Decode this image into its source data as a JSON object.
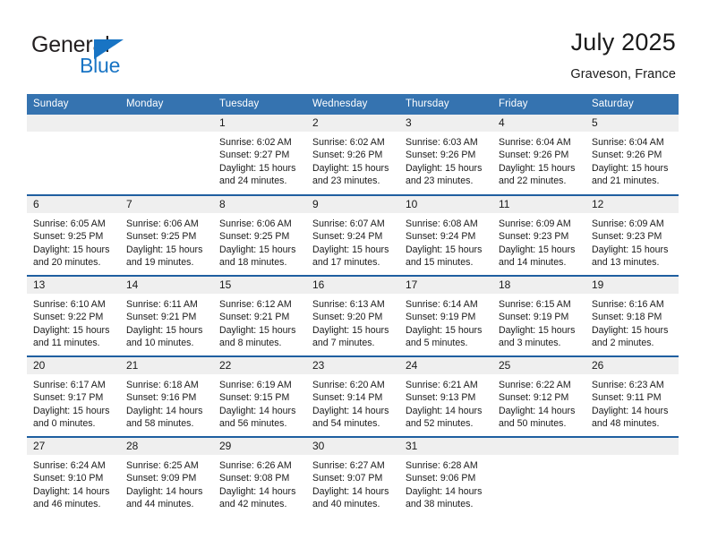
{
  "brand": {
    "name_top": "General",
    "name_bottom": "Blue",
    "triangle_icon": "triangle-icon",
    "accent_color": "#1874c4"
  },
  "header": {
    "title": "July 2025",
    "subtitle": "Graveson, France"
  },
  "colors": {
    "header_blue": "#3573b0",
    "row_rule_blue": "#1f5fa0",
    "daynum_band": "#efefef"
  },
  "calendar": {
    "day_headers": [
      "Sunday",
      "Monday",
      "Tuesday",
      "Wednesday",
      "Thursday",
      "Friday",
      "Saturday"
    ],
    "weeks": [
      [
        {
          "day": "",
          "sunrise": "",
          "sunset": "",
          "daylight": ""
        },
        {
          "day": "",
          "sunrise": "",
          "sunset": "",
          "daylight": ""
        },
        {
          "day": "1",
          "sunrise": "Sunrise: 6:02 AM",
          "sunset": "Sunset: 9:27 PM",
          "daylight": "Daylight: 15 hours and 24 minutes."
        },
        {
          "day": "2",
          "sunrise": "Sunrise: 6:02 AM",
          "sunset": "Sunset: 9:26 PM",
          "daylight": "Daylight: 15 hours and 23 minutes."
        },
        {
          "day": "3",
          "sunrise": "Sunrise: 6:03 AM",
          "sunset": "Sunset: 9:26 PM",
          "daylight": "Daylight: 15 hours and 23 minutes."
        },
        {
          "day": "4",
          "sunrise": "Sunrise: 6:04 AM",
          "sunset": "Sunset: 9:26 PM",
          "daylight": "Daylight: 15 hours and 22 minutes."
        },
        {
          "day": "5",
          "sunrise": "Sunrise: 6:04 AM",
          "sunset": "Sunset: 9:26 PM",
          "daylight": "Daylight: 15 hours and 21 minutes."
        }
      ],
      [
        {
          "day": "6",
          "sunrise": "Sunrise: 6:05 AM",
          "sunset": "Sunset: 9:25 PM",
          "daylight": "Daylight: 15 hours and 20 minutes."
        },
        {
          "day": "7",
          "sunrise": "Sunrise: 6:06 AM",
          "sunset": "Sunset: 9:25 PM",
          "daylight": "Daylight: 15 hours and 19 minutes."
        },
        {
          "day": "8",
          "sunrise": "Sunrise: 6:06 AM",
          "sunset": "Sunset: 9:25 PM",
          "daylight": "Daylight: 15 hours and 18 minutes."
        },
        {
          "day": "9",
          "sunrise": "Sunrise: 6:07 AM",
          "sunset": "Sunset: 9:24 PM",
          "daylight": "Daylight: 15 hours and 17 minutes."
        },
        {
          "day": "10",
          "sunrise": "Sunrise: 6:08 AM",
          "sunset": "Sunset: 9:24 PM",
          "daylight": "Daylight: 15 hours and 15 minutes."
        },
        {
          "day": "11",
          "sunrise": "Sunrise: 6:09 AM",
          "sunset": "Sunset: 9:23 PM",
          "daylight": "Daylight: 15 hours and 14 minutes."
        },
        {
          "day": "12",
          "sunrise": "Sunrise: 6:09 AM",
          "sunset": "Sunset: 9:23 PM",
          "daylight": "Daylight: 15 hours and 13 minutes."
        }
      ],
      [
        {
          "day": "13",
          "sunrise": "Sunrise: 6:10 AM",
          "sunset": "Sunset: 9:22 PM",
          "daylight": "Daylight: 15 hours and 11 minutes."
        },
        {
          "day": "14",
          "sunrise": "Sunrise: 6:11 AM",
          "sunset": "Sunset: 9:21 PM",
          "daylight": "Daylight: 15 hours and 10 minutes."
        },
        {
          "day": "15",
          "sunrise": "Sunrise: 6:12 AM",
          "sunset": "Sunset: 9:21 PM",
          "daylight": "Daylight: 15 hours and 8 minutes."
        },
        {
          "day": "16",
          "sunrise": "Sunrise: 6:13 AM",
          "sunset": "Sunset: 9:20 PM",
          "daylight": "Daylight: 15 hours and 7 minutes."
        },
        {
          "day": "17",
          "sunrise": "Sunrise: 6:14 AM",
          "sunset": "Sunset: 9:19 PM",
          "daylight": "Daylight: 15 hours and 5 minutes."
        },
        {
          "day": "18",
          "sunrise": "Sunrise: 6:15 AM",
          "sunset": "Sunset: 9:19 PM",
          "daylight": "Daylight: 15 hours and 3 minutes."
        },
        {
          "day": "19",
          "sunrise": "Sunrise: 6:16 AM",
          "sunset": "Sunset: 9:18 PM",
          "daylight": "Daylight: 15 hours and 2 minutes."
        }
      ],
      [
        {
          "day": "20",
          "sunrise": "Sunrise: 6:17 AM",
          "sunset": "Sunset: 9:17 PM",
          "daylight": "Daylight: 15 hours and 0 minutes."
        },
        {
          "day": "21",
          "sunrise": "Sunrise: 6:18 AM",
          "sunset": "Sunset: 9:16 PM",
          "daylight": "Daylight: 14 hours and 58 minutes."
        },
        {
          "day": "22",
          "sunrise": "Sunrise: 6:19 AM",
          "sunset": "Sunset: 9:15 PM",
          "daylight": "Daylight: 14 hours and 56 minutes."
        },
        {
          "day": "23",
          "sunrise": "Sunrise: 6:20 AM",
          "sunset": "Sunset: 9:14 PM",
          "daylight": "Daylight: 14 hours and 54 minutes."
        },
        {
          "day": "24",
          "sunrise": "Sunrise: 6:21 AM",
          "sunset": "Sunset: 9:13 PM",
          "daylight": "Daylight: 14 hours and 52 minutes."
        },
        {
          "day": "25",
          "sunrise": "Sunrise: 6:22 AM",
          "sunset": "Sunset: 9:12 PM",
          "daylight": "Daylight: 14 hours and 50 minutes."
        },
        {
          "day": "26",
          "sunrise": "Sunrise: 6:23 AM",
          "sunset": "Sunset: 9:11 PM",
          "daylight": "Daylight: 14 hours and 48 minutes."
        }
      ],
      [
        {
          "day": "27",
          "sunrise": "Sunrise: 6:24 AM",
          "sunset": "Sunset: 9:10 PM",
          "daylight": "Daylight: 14 hours and 46 minutes."
        },
        {
          "day": "28",
          "sunrise": "Sunrise: 6:25 AM",
          "sunset": "Sunset: 9:09 PM",
          "daylight": "Daylight: 14 hours and 44 minutes."
        },
        {
          "day": "29",
          "sunrise": "Sunrise: 6:26 AM",
          "sunset": "Sunset: 9:08 PM",
          "daylight": "Daylight: 14 hours and 42 minutes."
        },
        {
          "day": "30",
          "sunrise": "Sunrise: 6:27 AM",
          "sunset": "Sunset: 9:07 PM",
          "daylight": "Daylight: 14 hours and 40 minutes."
        },
        {
          "day": "31",
          "sunrise": "Sunrise: 6:28 AM",
          "sunset": "Sunset: 9:06 PM",
          "daylight": "Daylight: 14 hours and 38 minutes."
        },
        {
          "day": "",
          "sunrise": "",
          "sunset": "",
          "daylight": ""
        },
        {
          "day": "",
          "sunrise": "",
          "sunset": "",
          "daylight": ""
        }
      ]
    ]
  }
}
